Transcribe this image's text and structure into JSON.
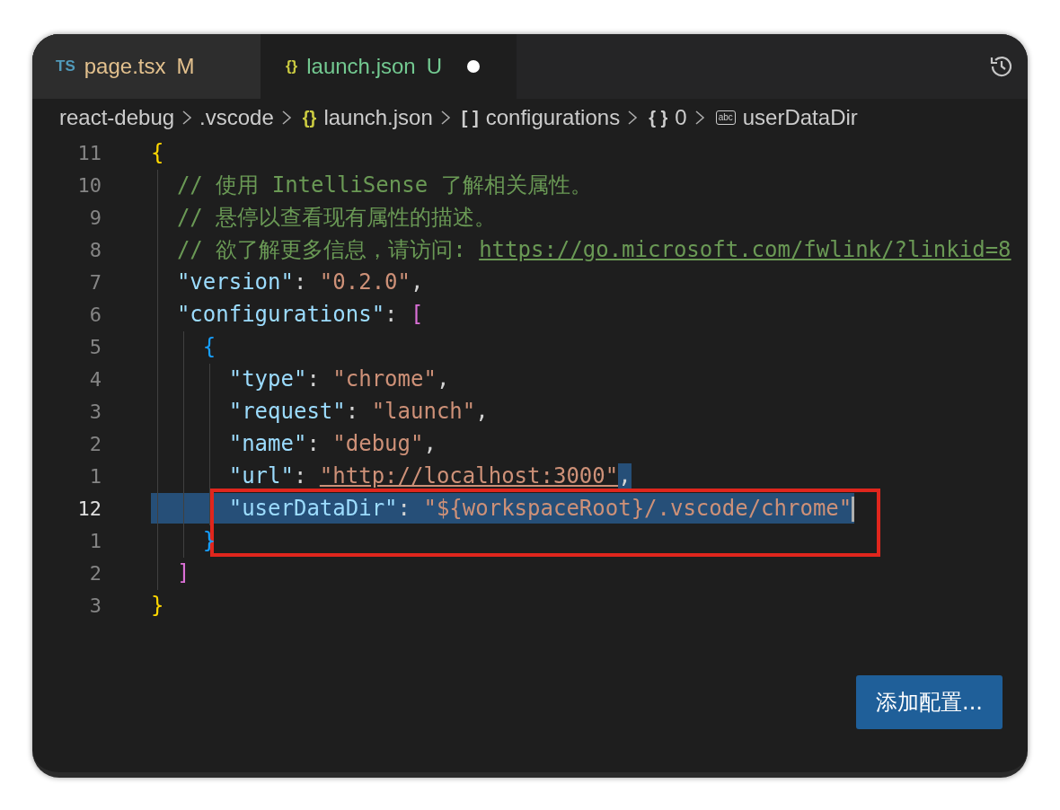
{
  "tabs": [
    {
      "icon": {
        "kind": "ts",
        "text": "TS"
      },
      "label": "page.tsx",
      "status": {
        "kind": "modified",
        "text": "M"
      },
      "selected": false,
      "dirty": false
    },
    {
      "icon": {
        "kind": "json",
        "text": "{}"
      },
      "label": "launch.json",
      "status": {
        "kind": "untracked",
        "text": "U"
      },
      "selected": true,
      "dirty": true
    }
  ],
  "breadcrumbs": [
    {
      "label": "react-debug"
    },
    {
      "label": ".vscode"
    },
    {
      "icon": {
        "kind": "json",
        "text": "{}"
      },
      "label": "launch.json"
    },
    {
      "icon": {
        "kind": "array",
        "text": "[ ]"
      },
      "label": "configurations"
    },
    {
      "icon": {
        "kind": "object",
        "text": "{ }"
      },
      "label": "0"
    },
    {
      "icon": {
        "kind": "string",
        "text": "abc"
      },
      "label": "userDataDir"
    }
  ],
  "lines": [
    {
      "number": "11",
      "current": false,
      "selected": false,
      "boxed": false,
      "tokens": [
        {
          "kind": "bracket1",
          "text": "{"
        }
      ],
      "children": [
        {
          "number": "10",
          "current": false,
          "selected": false,
          "boxed": false,
          "tokens": [
            {
              "kind": "comment",
              "text": "// 使用 IntelliSense 了解相关属性。"
            }
          ]
        },
        {
          "number": "9",
          "current": false,
          "selected": false,
          "boxed": false,
          "tokens": [
            {
              "kind": "comment",
              "text": "// 悬停以查看现有属性的描述。"
            }
          ]
        },
        {
          "number": "8",
          "current": false,
          "selected": false,
          "boxed": false,
          "tokens": [
            {
              "kind": "comment",
              "text": "// 欲了解更多信息，请访问: "
            },
            {
              "kind": "comment-link",
              "text": "https://go.microsoft.com/fwlink/?linkid=8"
            }
          ]
        },
        {
          "number": "7",
          "current": false,
          "selected": false,
          "boxed": false,
          "tokens": [
            {
              "kind": "key",
              "text": "\"version\""
            },
            {
              "kind": "punct",
              "text": ": "
            },
            {
              "kind": "string",
              "text": "\"0.2.0\""
            },
            {
              "kind": "punct",
              "text": ","
            }
          ]
        },
        {
          "number": "6",
          "current": false,
          "selected": false,
          "boxed": false,
          "tokens": [
            {
              "kind": "key",
              "text": "\"configurations\""
            },
            {
              "kind": "punct",
              "text": ": "
            },
            {
              "kind": "bracket2",
              "text": "["
            }
          ],
          "children": [
            {
              "number": "5",
              "current": false,
              "selected": false,
              "boxed": false,
              "tokens": [
                {
                  "kind": "bracket3",
                  "text": "{"
                }
              ],
              "children": [
                {
                  "number": "4",
                  "current": false,
                  "selected": false,
                  "boxed": false,
                  "tokens": [
                    {
                      "kind": "key",
                      "text": "\"type\""
                    },
                    {
                      "kind": "punct",
                      "text": ": "
                    },
                    {
                      "kind": "string",
                      "text": "\"chrome\""
                    },
                    {
                      "kind": "punct",
                      "text": ","
                    }
                  ]
                },
                {
                  "number": "3",
                  "current": false,
                  "selected": false,
                  "boxed": false,
                  "tokens": [
                    {
                      "kind": "key",
                      "text": "\"request\""
                    },
                    {
                      "kind": "punct",
                      "text": ": "
                    },
                    {
                      "kind": "string",
                      "text": "\"launch\""
                    },
                    {
                      "kind": "punct",
                      "text": ","
                    }
                  ]
                },
                {
                  "number": "2",
                  "current": false,
                  "selected": false,
                  "boxed": false,
                  "tokens": [
                    {
                      "kind": "key",
                      "text": "\"name\""
                    },
                    {
                      "kind": "punct",
                      "text": ": "
                    },
                    {
                      "kind": "string",
                      "text": "\"debug\""
                    },
                    {
                      "kind": "punct",
                      "text": ","
                    }
                  ]
                },
                {
                  "number": "1",
                  "current": false,
                  "selected": false,
                  "boxed": false,
                  "tokens": [
                    {
                      "kind": "key",
                      "text": "\"url\""
                    },
                    {
                      "kind": "punct",
                      "text": ": "
                    },
                    {
                      "kind": "string-link",
                      "text": "\"http://localhost:3000\""
                    },
                    {
                      "kind": "punct-selected",
                      "text": ","
                    }
                  ]
                },
                {
                  "number": "12",
                  "current": true,
                  "selected": true,
                  "boxed": true,
                  "tokens": [
                    {
                      "kind": "key",
                      "text": "\"userDataDir\""
                    },
                    {
                      "kind": "punct",
                      "text": ": "
                    },
                    {
                      "kind": "string",
                      "text": "\"${workspaceRoot}/.vscode/chrome\""
                    }
                  ]
                }
              ]
            },
            {
              "number": "1",
              "current": false,
              "selected": false,
              "boxed": false,
              "tokens": [
                {
                  "kind": "bracket3",
                  "text": "}"
                }
              ]
            }
          ]
        },
        {
          "number": "2",
          "current": false,
          "selected": false,
          "boxed": false,
          "tokens": [
            {
              "kind": "bracket2",
              "text": "]"
            }
          ]
        }
      ]
    },
    {
      "number": "3",
      "current": false,
      "selected": false,
      "boxed": false,
      "tokens": [
        {
          "kind": "bracket1",
          "text": "}"
        }
      ]
    }
  ],
  "add_configuration_button": "添加配置..."
}
